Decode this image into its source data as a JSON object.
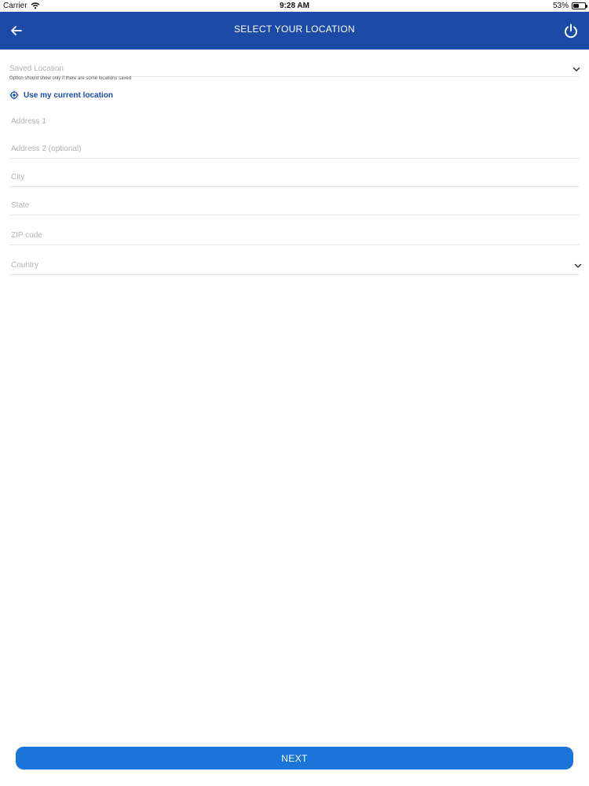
{
  "status_bar": {
    "carrier": "Carrier",
    "time": "9:28 AM",
    "battery_percent": "53%",
    "battery_level": 0.53,
    "icons": {
      "wifi": "wifi-icon",
      "battery": "battery-icon"
    }
  },
  "header": {
    "title": "SELECT YOUR LOCATION",
    "background_color": "#1c4aa7",
    "icons": {
      "back": "back-arrow-icon",
      "power": "power-icon"
    }
  },
  "form": {
    "saved_location": {
      "placeholder": "Saved Location",
      "helper": "Option should show only if there are some locations saved",
      "icon": "chevron-down-icon"
    },
    "current_location": {
      "label": "Use my current location",
      "icon": "target-icon"
    },
    "address1": {
      "placeholder": "Address 1"
    },
    "address2": {
      "placeholder": "Address 2 (optional)"
    },
    "city": {
      "placeholder": "City"
    },
    "state": {
      "placeholder": "State"
    },
    "zip": {
      "placeholder": "ZIP code"
    },
    "country": {
      "placeholder": "Country",
      "icon": "chevron-down-icon"
    }
  },
  "footer": {
    "next_label": "NEXT",
    "button_color": "#1b74d9"
  }
}
